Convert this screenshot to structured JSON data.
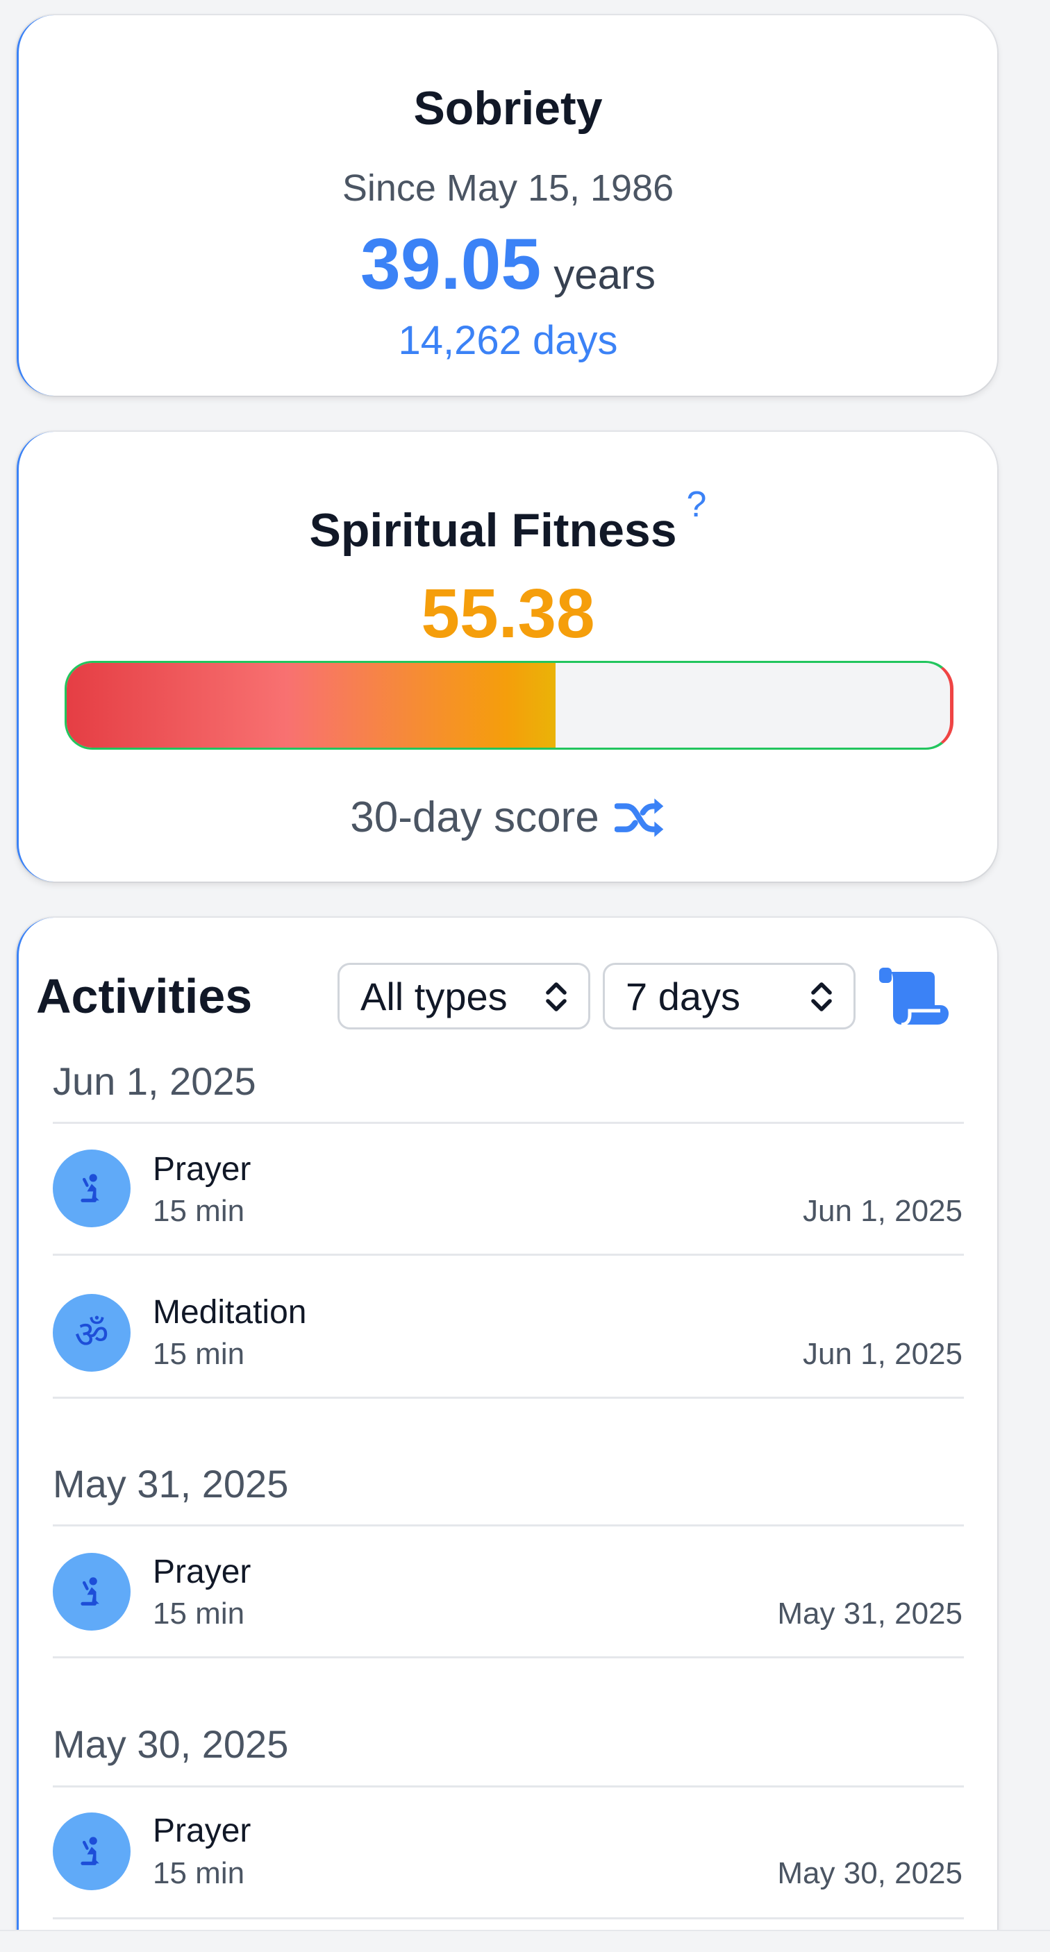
{
  "sobriety": {
    "title": "Sobriety",
    "since": "Since May 15, 1986",
    "years_value": "39.05",
    "years_unit": "years",
    "days": "14,262 days"
  },
  "fitness": {
    "title": "Spiritual Fitness",
    "help": "?",
    "score": "55.38",
    "score_fraction": 0.5538,
    "caption": "30-day score",
    "caption_icon": "shuffle-icon"
  },
  "activities": {
    "title": "Activities",
    "type_filter": {
      "selected": "All types"
    },
    "range_filter": {
      "selected": "7 days"
    },
    "log_icon": "scroll-icon",
    "groups": [
      {
        "date": "Jun 1, 2025",
        "items": [
          {
            "name": "Prayer",
            "duration": "15 min",
            "date": "Jun 1, 2025",
            "icon": "praying-icon"
          },
          {
            "name": "Meditation",
            "duration": "15 min",
            "date": "Jun 1, 2025",
            "icon": "om-icon"
          }
        ]
      },
      {
        "date": "May 31, 2025",
        "items": [
          {
            "name": "Prayer",
            "duration": "15 min",
            "date": "May 31, 2025",
            "icon": "praying-icon"
          }
        ]
      },
      {
        "date": "May 30, 2025",
        "items": [
          {
            "name": "Prayer",
            "duration": "15 min",
            "date": "May 30, 2025",
            "icon": "praying-icon"
          }
        ]
      }
    ]
  },
  "colors": {
    "accent": "#3b82f6",
    "score": "#f59e0b",
    "icon_bg": "#60aaf8"
  }
}
